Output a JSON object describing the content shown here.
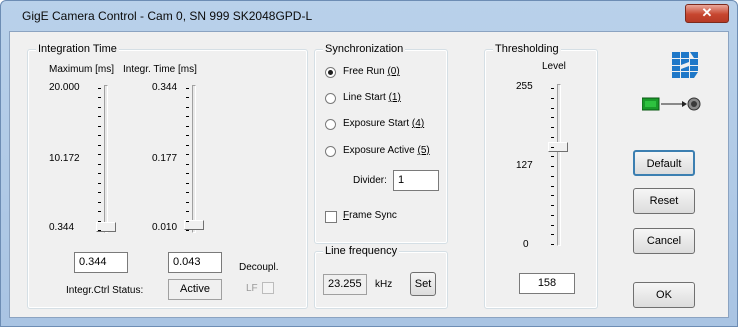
{
  "window": {
    "title": "GigE Camera Control - Cam 0, SN 999   SK2048GPD-L",
    "close_label": "✕"
  },
  "integration": {
    "group_label": "Integration Time",
    "max_header": "Maximum [ms]",
    "integr_header": "Integr. Time [ms]",
    "max_ticks": [
      "20.000",
      "10.172",
      "0.344"
    ],
    "integr_ticks": [
      "0.344",
      "0.177",
      "0.010"
    ],
    "max_value": "0.344",
    "integr_value": "0.043",
    "status_label": "Integr.Ctrl Status:",
    "status_value": "Active",
    "decoupl_label": "Decoupl.",
    "lf_label": "LF"
  },
  "sync": {
    "group_label": "Synchronization",
    "options": [
      {
        "text": "Free Run ",
        "key": "(0)",
        "selected": true
      },
      {
        "text": "Line Start ",
        "key": "(1)",
        "selected": false
      },
      {
        "text": "Exposure Start  ",
        "key": "(4)",
        "selected": false
      },
      {
        "text": "Exposure Active ",
        "key": "(5)",
        "selected": false
      }
    ],
    "divider_label": "Divider:",
    "divider_value": "1",
    "frame_sync_underlined": "F",
    "frame_sync_rest": "rame Sync"
  },
  "line_freq": {
    "group_label": "Line frequency",
    "value": "23.255",
    "unit": "kHz",
    "set_label": "Set"
  },
  "threshold": {
    "group_label": "Thresholding",
    "level_label": "Level",
    "ticks": [
      "255",
      "127",
      "0"
    ],
    "value": "158",
    "level_fraction": 0.62
  },
  "buttons": {
    "default_label": "Default",
    "reset_label": "Reset",
    "cancel_label": "Cancel",
    "ok_label": "OK"
  },
  "colors": {
    "logo_blue": "#1f78c8",
    "sensor_green": "#1a9a2a"
  }
}
